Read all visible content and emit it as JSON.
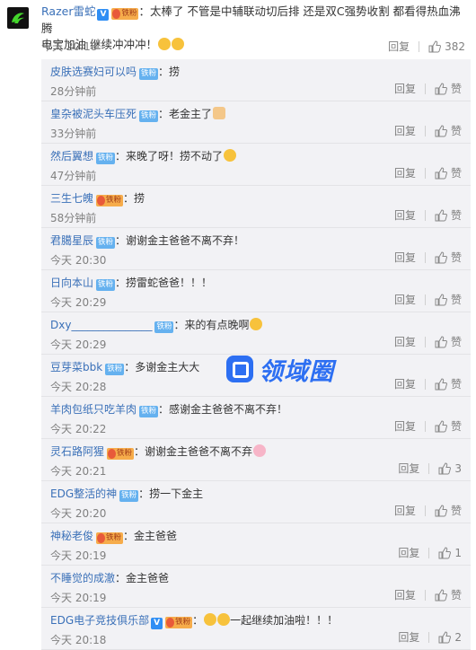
{
  "main": {
    "user": "Razer雷蛇",
    "badge_v": "V",
    "badge_fan": "铁粉",
    "text_line1": "：太棒了 不管是中辅联动切后排 还是双C强势收割 都看得热血沸腾",
    "text_line2": "电宝加油 继续冲冲冲！",
    "time": "今天 20:18",
    "reply_label": "回复",
    "like_count": "382"
  },
  "labels": {
    "reply": "回复",
    "like": "赞",
    "fan": "铁粉"
  },
  "replies": [
    {
      "user": "皮肤选赛妇可以吗",
      "badge": "铁粉",
      "text": "：捞",
      "time": "28分钟前",
      "like": "赞"
    },
    {
      "user": "皇杂被泥头车压死",
      "badge": "铁粉",
      "text": "：老金主了",
      "time": "33分钟前",
      "like": "赞"
    },
    {
      "user": "然后翼想",
      "badge": "铁粉",
      "text": "：来晚了呀！捞不动了",
      "time": "47分钟前",
      "like": "赞"
    },
    {
      "user": "三生七魄",
      "badge": "铁粉",
      "text": "：捞",
      "time": "58分钟前",
      "like": "赞"
    },
    {
      "user": "君臈星辰",
      "badge": "铁粉",
      "text": "：谢谢金主爸爸不离不弃！",
      "time": "今天 20:30",
      "like": "赞"
    },
    {
      "user": "日向本山",
      "badge": "铁粉",
      "text": "：捞雷蛇爸爸！！！",
      "time": "今天 20:29",
      "like": "赞"
    },
    {
      "user": "Dxy_______________",
      "badge": "铁粉",
      "text": "：来的有点晚啊",
      "time": "今天 20:29",
      "like": "赞"
    },
    {
      "user": "豆芽菜bbk",
      "badge": "铁粉",
      "text": "：多谢金主大大",
      "time": "今天 20:28",
      "like": "赞"
    },
    {
      "user": "羊肉包纸只吃羊肉",
      "badge": "铁粉",
      "text": "：感谢金主爸爸不离不弃！",
      "time": "今天 20:22",
      "like": "赞"
    },
    {
      "user": "灵石路阿猩",
      "badge": "铁粉",
      "text": "：谢谢金主爸爸不离不弃",
      "time": "今天 20:21",
      "like": "3"
    },
    {
      "user": "EDG整活的神",
      "badge": "铁粉",
      "text": "：捞一下金主",
      "time": "今天 20:20",
      "like": "赞"
    },
    {
      "user": "神秘老俊",
      "badge": "铁粉",
      "text": "：金主爸爸",
      "time": "今天 20:19",
      "like": "1"
    },
    {
      "user": "不睡觉的成澈",
      "badge": "",
      "text": "：金主爸爸",
      "time": "今天 20:19",
      "like": "赞"
    },
    {
      "user": "EDG电子竞技俱乐部",
      "badge": "铁粉",
      "text": "一起继续加油啦！！！",
      "time": "今天 20:18",
      "like": "2"
    }
  ],
  "watermark": "领域圈",
  "colors": {
    "link": "#3a70b8",
    "accent": "#eb7350",
    "badge": "#65b1ef",
    "reply_bg": "#f2f2f5",
    "watermark": "#2d6ff2"
  }
}
